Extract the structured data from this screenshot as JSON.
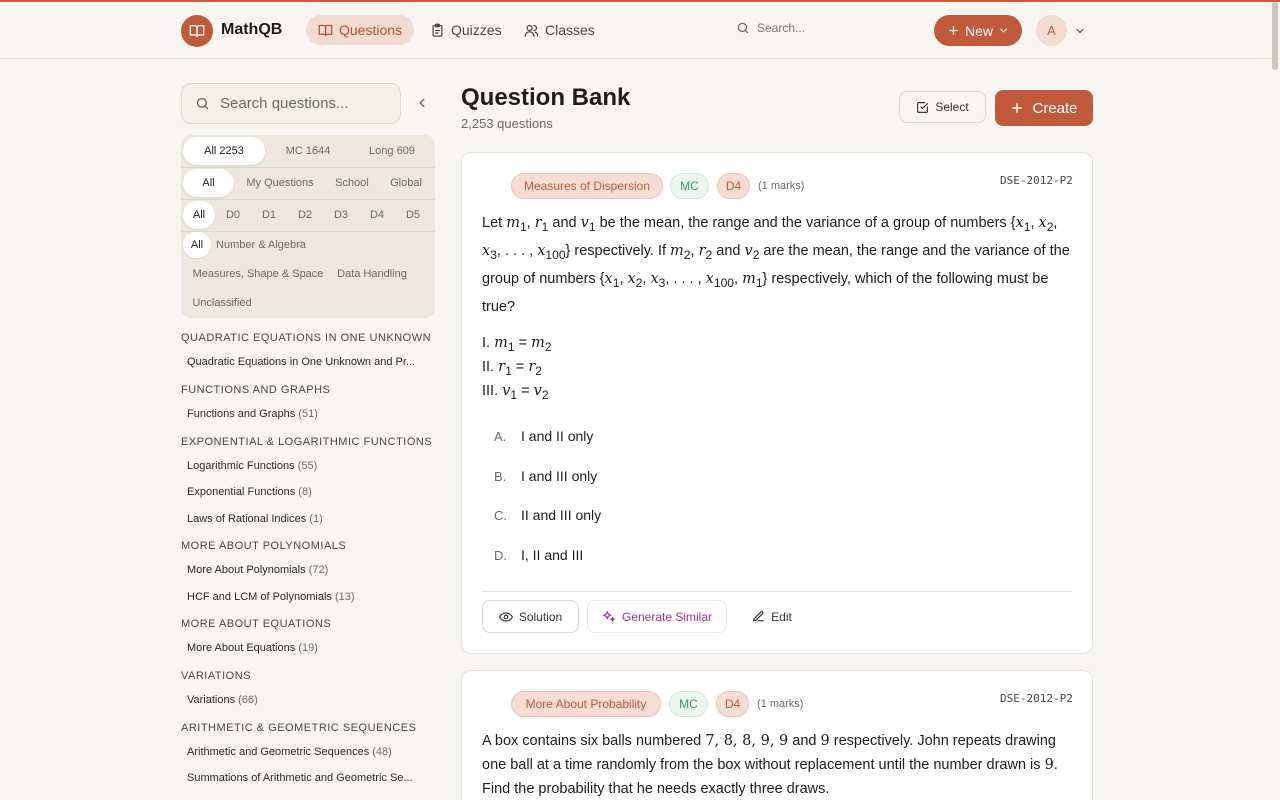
{
  "app": {
    "name": "MathQB"
  },
  "nav": [
    {
      "label": "Questions",
      "icon": "book-icon",
      "active": true
    },
    {
      "label": "Quizzes",
      "icon": "clipboard-icon",
      "active": false
    },
    {
      "label": "Classes",
      "icon": "users-icon",
      "active": false
    }
  ],
  "header": {
    "search_placeholder": "Search...",
    "new_label": "New",
    "avatar_initial": "A"
  },
  "sidebar": {
    "search_placeholder": "Search questions...",
    "type_filters": [
      "All 2253",
      "MC 1644",
      "Long 609"
    ],
    "owner_filters": [
      "All",
      "My Questions",
      "School",
      "Global"
    ],
    "difficulty_filters": [
      "All",
      "D0",
      "D1",
      "D2",
      "D3",
      "D4",
      "D5"
    ],
    "strand_filters": [
      "All",
      "Number & Algebra",
      "Measures, Shape & Space",
      "Data Handling",
      "Unclassified"
    ],
    "sections": [
      {
        "heading": "QUADRATIC EQUATIONS IN ONE UNKNOWN",
        "topics": [
          {
            "name": "Quadratic Equations in One Unknown and Pr...",
            "count": ""
          }
        ]
      },
      {
        "heading": "FUNCTIONS AND GRAPHS",
        "topics": [
          {
            "name": "Functions and Graphs",
            "count": "(51)"
          }
        ]
      },
      {
        "heading": "EXPONENTIAL & LOGARITHMIC FUNCTIONS",
        "topics": [
          {
            "name": "Logarithmic Functions",
            "count": "(55)"
          },
          {
            "name": "Exponential Functions",
            "count": "(8)"
          },
          {
            "name": "Laws of Rational Indices",
            "count": "(1)"
          }
        ]
      },
      {
        "heading": "MORE ABOUT POLYNOMIALS",
        "topics": [
          {
            "name": "More About Polynomials",
            "count": "(72)"
          },
          {
            "name": "HCF and LCM of Polynomials",
            "count": "(13)"
          }
        ]
      },
      {
        "heading": "MORE ABOUT EQUATIONS",
        "topics": [
          {
            "name": "More About Equations",
            "count": "(19)"
          }
        ]
      },
      {
        "heading": "VARIATIONS",
        "topics": [
          {
            "name": "Variations",
            "count": "(66)"
          }
        ]
      },
      {
        "heading": "ARITHMETIC & GEOMETRIC SEQUENCES",
        "topics": [
          {
            "name": "Arithmetic and Geometric Sequences",
            "count": "(48)"
          },
          {
            "name": "Summations of Arithmetic and Geometric Se...",
            "count": ""
          }
        ]
      }
    ]
  },
  "main": {
    "title": "Question Bank",
    "subtitle": "2,253 questions",
    "select_label": "Select",
    "create_label": "Create",
    "questions": [
      {
        "topic": "Measures of Dispersion",
        "type": "MC",
        "difficulty": "D4",
        "marks": "(1 marks)",
        "code": "DSE-2012-P2",
        "statements": [
          "I.",
          "II.",
          "III."
        ],
        "options": [
          {
            "letter": "A.",
            "text": "I and II only"
          },
          {
            "letter": "B.",
            "text": "I and III only"
          },
          {
            "letter": "C.",
            "text": "II and III only"
          },
          {
            "letter": "D.",
            "text": "I, II and III"
          }
        ],
        "actions": {
          "solution": "Solution",
          "generate": "Generate Similar",
          "edit": "Edit"
        }
      },
      {
        "topic": "More About Probability",
        "type": "MC",
        "difficulty": "D4",
        "marks": "(1 marks)",
        "code": "DSE-2012-P2"
      }
    ]
  },
  "colors": {
    "accent": "#c15a3a",
    "accent_soft": "#f2dcd1",
    "mc_green": "#3f9a6a",
    "generate_purple": "#a2308c"
  }
}
